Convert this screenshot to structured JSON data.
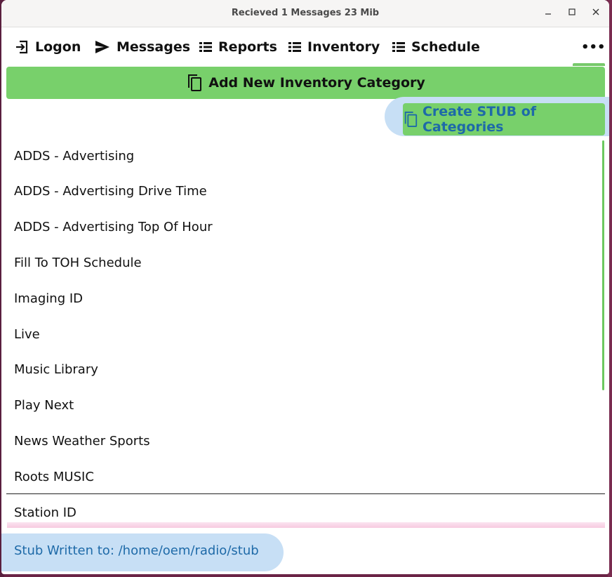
{
  "window": {
    "title": "Recieved 1 Messages  23 Mib",
    "controls": [
      "minimize-icon",
      "maximize-icon",
      "close-icon"
    ]
  },
  "nav": {
    "logon": "Logon",
    "messages": "Messages",
    "reports": "Reports",
    "inventory": "Inventory",
    "schedule": "Schedule",
    "more": "•••"
  },
  "buttons": {
    "add_category": "Add New Inventory Category",
    "create_stub": "Create STUB of Categories"
  },
  "categories": [
    "ADDS - Advertising",
    "ADDS - Advertising Drive Time",
    "ADDS - Advertising Top Of Hour",
    "Fill To TOH Schedule",
    "Imaging ID",
    "Live",
    "Music Library",
    "Play Next",
    "News Weather Sports",
    "Roots MUSIC",
    "Station ID"
  ],
  "status": {
    "message": "Stub Written to: /home/oem/radio/stub"
  },
  "colors": {
    "accent_green": "#78d06b",
    "highlight_blue": "#c7dff5",
    "link_blue": "#1e6aa8"
  }
}
